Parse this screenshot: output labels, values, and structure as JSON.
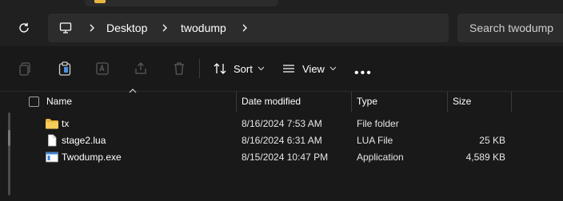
{
  "address_bar": {
    "breadcrumbs": [
      {
        "label": "Desktop"
      },
      {
        "label": "twodump"
      }
    ]
  },
  "search": {
    "placeholder": "Search twodump"
  },
  "toolbar": {
    "sort_label": "Sort",
    "view_label": "View",
    "more_label": "•••"
  },
  "columns": {
    "name": "Name",
    "date_modified": "Date modified",
    "type": "Type",
    "size": "Size"
  },
  "files": [
    {
      "name": "tx",
      "date": "8/16/2024 7:53 AM",
      "type": "File folder",
      "size": "",
      "icon": "folder-icon"
    },
    {
      "name": "stage2.lua",
      "date": "8/16/2024 6:31 AM",
      "type": "LUA File",
      "size": "25 KB",
      "icon": "file-icon"
    },
    {
      "name": "Twodump.exe",
      "date": "8/15/2024 10:47 PM",
      "type": "Application",
      "size": "4,589 KB",
      "icon": "application-icon"
    }
  ],
  "colors": {
    "folder": "#f2c14e",
    "exe_accent": "#3b82d6",
    "background": "#191919"
  }
}
